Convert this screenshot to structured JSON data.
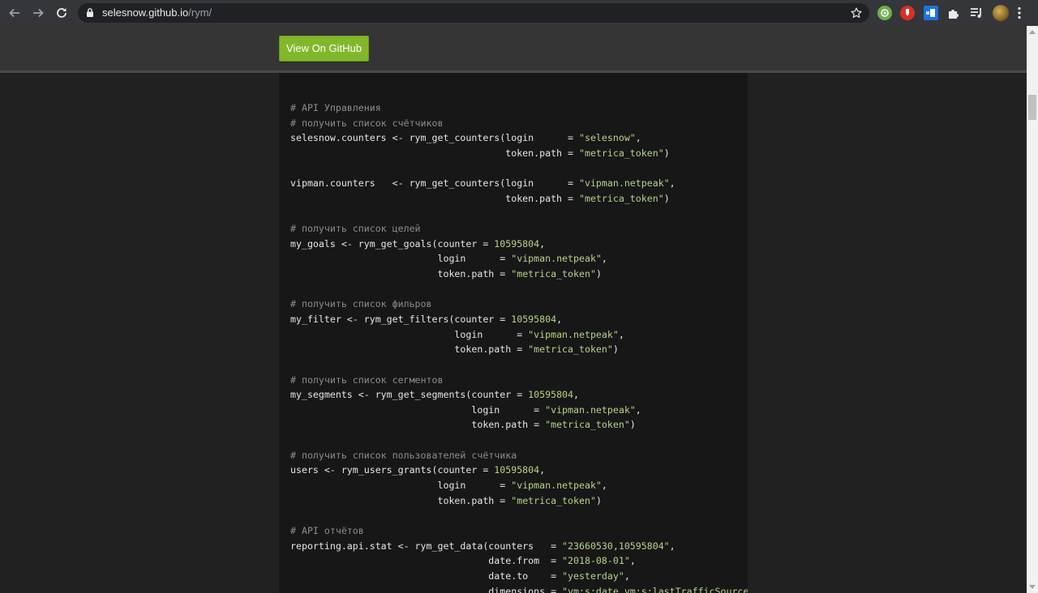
{
  "browser": {
    "url_host": "selesnow.github.io",
    "url_path": "/rym/",
    "icons": [
      "back-arrow-icon",
      "forward-arrow-icon",
      "reload-icon",
      "lock-icon",
      "bookmark-star-icon",
      "extension-green-icon",
      "extension-red-icon",
      "extension-blue-icon",
      "puzzle-icon",
      "reading-list-icon",
      "profile-avatar-icon",
      "kebab-menu-icon"
    ],
    "colors": {
      "toolbar": "#35363a",
      "omnibox": "#202124"
    }
  },
  "header": {
    "github_button_label": "View On GitHub",
    "colors": {
      "background": "#353535",
      "button": "#81b82b"
    }
  },
  "code": {
    "lines": [
      [
        {
          "t": "c",
          "v": "# API Управления"
        }
      ],
      [
        {
          "t": "c",
          "v": "# получить список счётчиков"
        }
      ],
      [
        {
          "t": "p",
          "v": "selesnow.counters <- rym_get_counters(login      = "
        },
        {
          "t": "s",
          "v": "\"selesnow\""
        },
        {
          "t": "p",
          "v": ","
        }
      ],
      [
        {
          "t": "p",
          "v": "                                      token.path = "
        },
        {
          "t": "s",
          "v": "\"metrica_token\""
        },
        {
          "t": "p",
          "v": ")"
        }
      ],
      [],
      [
        {
          "t": "p",
          "v": "vipman.counters   <- rym_get_counters(login      = "
        },
        {
          "t": "s",
          "v": "\"vipman.netpeak\""
        },
        {
          "t": "p",
          "v": ","
        }
      ],
      [
        {
          "t": "p",
          "v": "                                      token.path = "
        },
        {
          "t": "s",
          "v": "\"metrica_token\""
        },
        {
          "t": "p",
          "v": ")"
        }
      ],
      [],
      [
        {
          "t": "c",
          "v": "# получить список целей"
        }
      ],
      [
        {
          "t": "p",
          "v": "my_goals <- rym_get_goals(counter = "
        },
        {
          "t": "n",
          "v": "10595804"
        },
        {
          "t": "p",
          "v": ","
        }
      ],
      [
        {
          "t": "p",
          "v": "                          login      = "
        },
        {
          "t": "s",
          "v": "\"vipman.netpeak\""
        },
        {
          "t": "p",
          "v": ","
        }
      ],
      [
        {
          "t": "p",
          "v": "                          token.path = "
        },
        {
          "t": "s",
          "v": "\"metrica_token\""
        },
        {
          "t": "p",
          "v": ")"
        }
      ],
      [],
      [
        {
          "t": "c",
          "v": "# получить список фильров"
        }
      ],
      [
        {
          "t": "p",
          "v": "my_filter <- rym_get_filters(counter = "
        },
        {
          "t": "n",
          "v": "10595804"
        },
        {
          "t": "p",
          "v": ","
        }
      ],
      [
        {
          "t": "p",
          "v": "                             login      = "
        },
        {
          "t": "s",
          "v": "\"vipman.netpeak\""
        },
        {
          "t": "p",
          "v": ","
        }
      ],
      [
        {
          "t": "p",
          "v": "                             token.path = "
        },
        {
          "t": "s",
          "v": "\"metrica_token\""
        },
        {
          "t": "p",
          "v": ")"
        }
      ],
      [],
      [
        {
          "t": "c",
          "v": "# получить список сегментов"
        }
      ],
      [
        {
          "t": "p",
          "v": "my_segments <- rym_get_segments(counter = "
        },
        {
          "t": "n",
          "v": "10595804"
        },
        {
          "t": "p",
          "v": ","
        }
      ],
      [
        {
          "t": "p",
          "v": "                                login      = "
        },
        {
          "t": "s",
          "v": "\"vipman.netpeak\""
        },
        {
          "t": "p",
          "v": ","
        }
      ],
      [
        {
          "t": "p",
          "v": "                                token.path = "
        },
        {
          "t": "s",
          "v": "\"metrica_token\""
        },
        {
          "t": "p",
          "v": ")"
        }
      ],
      [],
      [
        {
          "t": "c",
          "v": "# получить список пользователей счётчика"
        }
      ],
      [
        {
          "t": "p",
          "v": "users <- rym_users_grants(counter = "
        },
        {
          "t": "n",
          "v": "10595804"
        },
        {
          "t": "p",
          "v": ","
        }
      ],
      [
        {
          "t": "p",
          "v": "                          login      = "
        },
        {
          "t": "s",
          "v": "\"vipman.netpeak\""
        },
        {
          "t": "p",
          "v": ","
        }
      ],
      [
        {
          "t": "p",
          "v": "                          token.path = "
        },
        {
          "t": "s",
          "v": "\"metrica_token\""
        },
        {
          "t": "p",
          "v": ")"
        }
      ],
      [],
      [
        {
          "t": "c",
          "v": "# API отчётов"
        }
      ],
      [
        {
          "t": "p",
          "v": "reporting.api.stat <- rym_get_data(counters   = "
        },
        {
          "t": "s",
          "v": "\"23660530,10595804\""
        },
        {
          "t": "p",
          "v": ","
        }
      ],
      [
        {
          "t": "p",
          "v": "                                   date.from  = "
        },
        {
          "t": "s",
          "v": "\"2018-08-01\""
        },
        {
          "t": "p",
          "v": ","
        }
      ],
      [
        {
          "t": "p",
          "v": "                                   date.to    = "
        },
        {
          "t": "s",
          "v": "\"yesterday\""
        },
        {
          "t": "p",
          "v": ","
        }
      ],
      [
        {
          "t": "p",
          "v": "                                   dimensions = "
        },
        {
          "t": "s",
          "v": "\"ym:s:date,ym:s:lastTrafficSource"
        }
      ]
    ],
    "colors": {
      "background": "#171717",
      "text": "#e6e6e6",
      "comment": "#8c8c8c",
      "string": "#b5d485"
    }
  }
}
